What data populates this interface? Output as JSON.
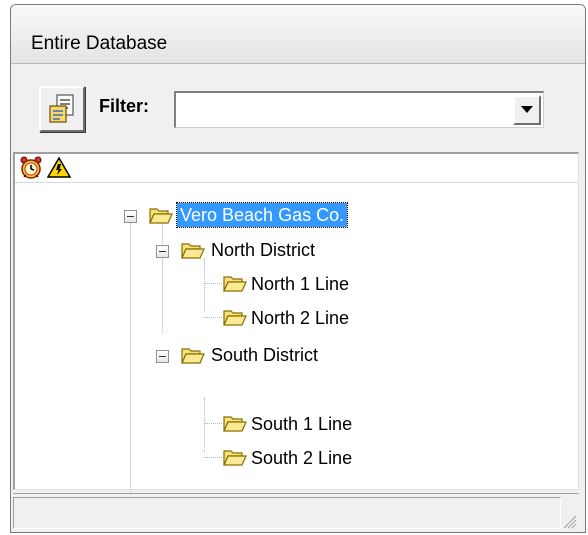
{
  "window": {
    "title": "Entire Database"
  },
  "toolbar": {
    "report_button_icon": "report-icon",
    "filter_label": "Filter:",
    "filter_value": "",
    "dropdown_icon": "chevron-down-icon"
  },
  "status_icons": [
    {
      "name": "alarm-icon"
    },
    {
      "name": "warning-icon"
    }
  ],
  "tree": {
    "root": {
      "label": "Vero Beach Gas Co.",
      "expanded": true,
      "selected": true,
      "children": [
        {
          "label": "North District",
          "expanded": true,
          "children": [
            {
              "label": "North 1 Line"
            },
            {
              "label": "North 2 Line"
            }
          ]
        },
        {
          "label": "South District",
          "expanded": true,
          "children": [
            {
              "label": "South 1 Line"
            },
            {
              "label": "South 2 Line"
            }
          ]
        }
      ]
    }
  },
  "colors": {
    "selection": "#3399ff",
    "folder_fill": "#f5e17a",
    "folder_stroke": "#8a6d00"
  }
}
